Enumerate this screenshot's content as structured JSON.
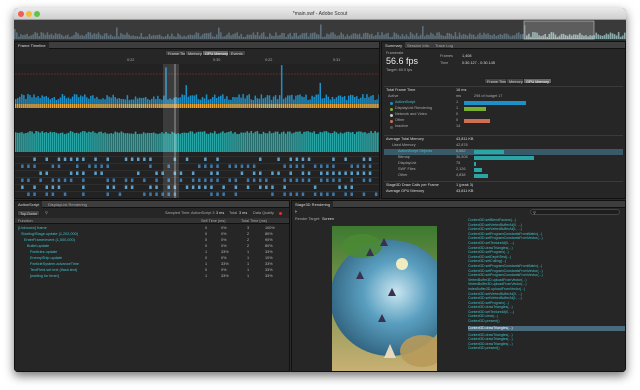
{
  "window": {
    "title": "*main.swf - Adobe Scout"
  },
  "frame_timeline": {
    "panel_title": "Frame Timeline",
    "tabs": [
      "Frame Time",
      "Memory",
      "GPU Memory",
      "Events"
    ],
    "active_tab": "GPU Memory",
    "ruler": [
      "0:22",
      "0:30",
      "0:22",
      "0:31"
    ],
    "section_frame_time": "Frame Time",
    "section_memory": "Memory"
  },
  "summary": {
    "tabs": [
      "Summary",
      "Session Info",
      "Trace Log"
    ],
    "framerate_label": "Framerate",
    "framerate_value": "56.6 fps",
    "target_label": "Target: 60.0 fps",
    "frames_label": "Frames",
    "frames_value": "1,408",
    "time_label": "Time",
    "time_value": "0:30.127 - 0:30.145",
    "frame_tabs": [
      "Frame Time",
      "Memory",
      "GPU Memory"
    ],
    "total_frame_time_label": "Total Frame Time",
    "total_frame_time_value": "16 ms",
    "active_label": "Active",
    "active_value": "ms",
    "active_note": "298 of budget 17",
    "rows": [
      {
        "label": "ActionScript",
        "value": "1"
      },
      {
        "label": "DisplayList Rendering",
        "value": "1"
      },
      {
        "label": "Network and Video",
        "value": "0"
      },
      {
        "label": "Other",
        "value": "0"
      },
      {
        "label": "Inactive",
        "value": "14"
      }
    ],
    "avg_memory_label": "Average Total Memory",
    "avg_memory_value": "43,811 KB",
    "memory_rows": [
      {
        "label": "Used Memory",
        "value": "42,878"
      },
      {
        "label": "ActionScript Objects",
        "value": "8,682"
      },
      {
        "label": "Bitmap",
        "value": "36,508"
      },
      {
        "label": "DisplayList",
        "value": "75"
      },
      {
        "label": "SWF Files",
        "value": "2,126"
      },
      {
        "label": "Other",
        "value": "4,838"
      }
    ],
    "stage3d_label": "Stage3D Draw Calls per Frame",
    "stage3d_value": "1 (peak 3)",
    "avg_gpu_label": "Average GPU Memory",
    "avg_gpu_value": "43,811 KB"
  },
  "actionscript": {
    "tabs": [
      "ActionScript",
      "DisplayList Rendering"
    ],
    "top_down_label": "Top-Down",
    "sampled_time": "Sampled Time:",
    "as3_label": "ActionScript 3",
    "as3_value": "3 ms",
    "total_label": "Total",
    "total_value": "3 ms",
    "quality_label": "Data Quality",
    "columns": [
      "Function",
      "Self Time (ms)",
      "",
      "Total Time (ms)",
      ""
    ],
    "rows": [
      {
        "name": "[Unknown] frame",
        "self": "0",
        "selfp": "0%",
        "total": "3",
        "totalp": "100%"
      },
      {
        "name": "Starling/Stage.update (1,202,000)",
        "self": "0",
        "selfp": "0%",
        "total": "2",
        "totalp": "80%"
      },
      {
        "name": "EnterFrame/event (1,500,000)",
        "self": "0",
        "selfp": "0%",
        "total": "2",
        "totalp": "90%"
      },
      {
        "name": "Bullet.update",
        "self": "0",
        "selfp": "0%",
        "total": "2",
        "totalp": "80%"
      },
      {
        "name": "Particles.update",
        "self": "1",
        "selfp": "33%",
        "total": "1",
        "totalp": "33%"
      },
      {
        "name": "EnemyShip.update",
        "self": "0",
        "selfp": "0%",
        "total": "1",
        "totalp": "10%"
      },
      {
        "name": "ParticleSystem.advanceTime",
        "self": "1",
        "selfp": "33%",
        "total": "1",
        "totalp": "33%"
      },
      {
        "name": "TextField.set text (flash.text)",
        "self": "0",
        "selfp": "0%",
        "total": "1",
        "totalp": "33%"
      },
      {
        "name": "[waiting for timer]",
        "self": "1",
        "selfp": "33%",
        "total": "1",
        "totalp": "33%"
      }
    ]
  },
  "stage3d": {
    "tab": "Stage3D Rendering",
    "render_target_label": "Render Target:",
    "render_target_value": "Screen",
    "log": [
      "Context3D.setBlendFactors(...)",
      "Context3D.setVertexBufferAt(0, ...)",
      "Context3D.setVertexBufferAt(1, ...)",
      "Context3D.setProgramConstantsFromMatrix(...)",
      "Context3D.setProgramConstantsFromVector(...)",
      "Context3D.setTextureAt(0, ...)",
      "Context3D.drawTriangles(...)",
      "Context3D.setProgram(...)",
      "Context3D.setDepthTest(...)",
      "Context3D.setCulling(...)",
      "Context3D.setProgramConstantsFromMatrix(...)",
      "Context3D.setProgramConstantsFromVector(...)",
      "Context3D.setProgramConstantsFromVector(...)",
      "VertexBuffer3D.uploadFromVector(...)",
      "VertexBuffer3D.uploadFromVector(...)",
      "IndexBuffer3D.uploadFromVector(...)",
      "Context3D.setVertexBufferAt(0, ...)",
      "Context3D.setVertexBufferAt(1, ...)",
      "Context3D.setProgram(...)",
      "Context3D.drawTriangles(...)",
      "Context3D.setTextureAt(0, ...)",
      "Context3D.clear(...)",
      "Context3D.present()"
    ],
    "log_selected": "Context3D.drawTriangles(...)",
    "log_after": [
      "Context3D.drawTriangles(...)",
      "Context3D.drawTriangles(...)",
      "Context3D.drawTriangles(...)",
      "Context3D.present()"
    ]
  },
  "colors": {
    "accent": "#3fc3c8",
    "as": "#1e90c8",
    "render": "#7ab030",
    "network": "#c8c8c8",
    "other": "#d07050",
    "memory": "#2aa5a5"
  }
}
